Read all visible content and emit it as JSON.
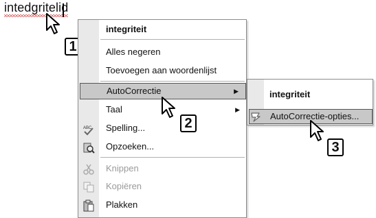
{
  "document": {
    "misspelled_word": "intedgritelid"
  },
  "context_menu": {
    "suggestion": "integriteit",
    "ignore_all": "Alles negeren",
    "add_to_dictionary": "Toevoegen aan woordenlijst",
    "autocorrect": "AutoCorrectie",
    "language": "Taal",
    "spelling": "Spelling...",
    "lookup": "Opzoeken...",
    "cut": "Knippen",
    "copy": "Kopiëren",
    "paste": "Plakken"
  },
  "submenu": {
    "suggestion": "integriteit",
    "autocorrect_options": "AutoCorrectie-opties..."
  },
  "callouts": {
    "step1": "1",
    "step2": "2",
    "step3": "3"
  },
  "icons": {
    "mouse": "mouse-icon",
    "spelling": "spelling-check-icon",
    "lookup": "research-icon",
    "cut": "scissors-icon",
    "copy": "copy-icon",
    "paste": "clipboard-icon",
    "autocorrect_options": "autocorrect-lightning-icon",
    "submenu_arrow": "triangle-right-icon",
    "pointer": "arrow-cursor-icon"
  }
}
